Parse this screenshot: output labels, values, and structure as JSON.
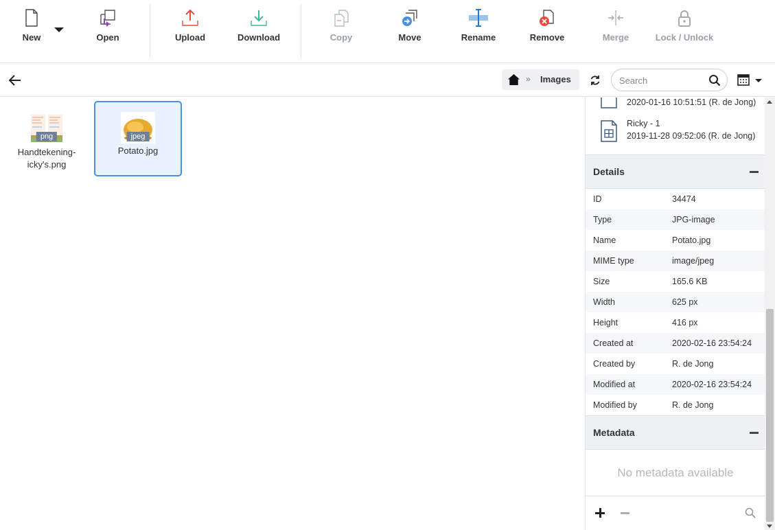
{
  "toolbar": {
    "new_label": "New",
    "open_label": "Open",
    "upload_label": "Upload",
    "download_label": "Download",
    "copy_label": "Copy",
    "move_label": "Move",
    "rename_label": "Rename",
    "remove_label": "Remove",
    "merge_label": "Merge",
    "lock_label": "Lock / Unlock"
  },
  "breadcrumb": {
    "separator": "»",
    "current": "Images"
  },
  "search": {
    "placeholder": "Search",
    "value": ""
  },
  "files": [
    {
      "name": "Handtekening-icky's.png",
      "tag": "png"
    },
    {
      "name": "Potato.jpg",
      "tag": "jpeg"
    }
  ],
  "versions": [
    {
      "date": "2020-01-16 10:51:51 (R. de Jong)"
    },
    {
      "name": "Ricky - 1",
      "date": "2019-11-28 09:52:06 (R. de Jong)"
    }
  ],
  "details": {
    "title": "Details",
    "rows": [
      {
        "key": "ID",
        "value": "34474"
      },
      {
        "key": "Type",
        "value": "JPG-image"
      },
      {
        "key": "Name",
        "value": "Potato.jpg"
      },
      {
        "key": "MIME type",
        "value": "image/jpeg"
      },
      {
        "key": "Size",
        "value": "165.6 KB"
      },
      {
        "key": "Width",
        "value": "625 px"
      },
      {
        "key": "Height",
        "value": "416 px"
      },
      {
        "key": "Created at",
        "value": "2020-02-16 23:54:24"
      },
      {
        "key": "Created by",
        "value": "R. de Jong"
      },
      {
        "key": "Modified at",
        "value": "2020-02-16 23:54:24"
      },
      {
        "key": "Modified by",
        "value": "R. de Jong"
      }
    ]
  },
  "metadata": {
    "title": "Metadata",
    "empty_text": "No metadata available"
  },
  "colors": {
    "upload": "#e74c3c",
    "download": "#3cb89a",
    "move": "#4a90e2",
    "remove": "#e74c3c",
    "open": "#8e44ad",
    "selection": "#4a90e2"
  }
}
